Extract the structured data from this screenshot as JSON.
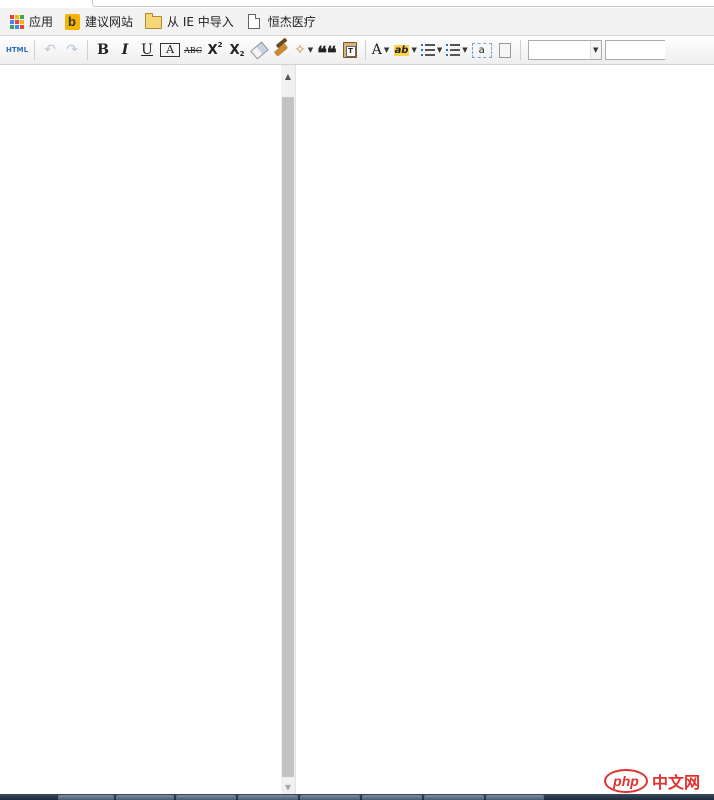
{
  "bookmarks": {
    "items": [
      {
        "label": "应用",
        "icon": "apps-grid-icon"
      },
      {
        "label": "建议网站",
        "icon": "bing-icon"
      },
      {
        "label": "从 IE 中导入",
        "icon": "folder-icon"
      },
      {
        "label": "恒杰医疗",
        "icon": "page-icon"
      }
    ]
  },
  "toolbar": {
    "html_label": "HTML",
    "bold_label": "B",
    "italic_label": "I",
    "underline_label": "U",
    "fontborder_label": "A",
    "strike_label": "ABC",
    "superscript_label": "X",
    "subscript_label": "X",
    "quote_label": "❝❝",
    "paste_label": "T",
    "forecolor_label": "A",
    "backcolor_label": "ab",
    "anchor_label": "a",
    "font_family_value": "",
    "font_size_value": ""
  },
  "colors": {
    "accent": "#2a6fbf",
    "scroll_thumb": "#c3c3c3",
    "watermark": "#e2322f"
  },
  "watermark": {
    "php": "php",
    "cn": "中文网"
  }
}
